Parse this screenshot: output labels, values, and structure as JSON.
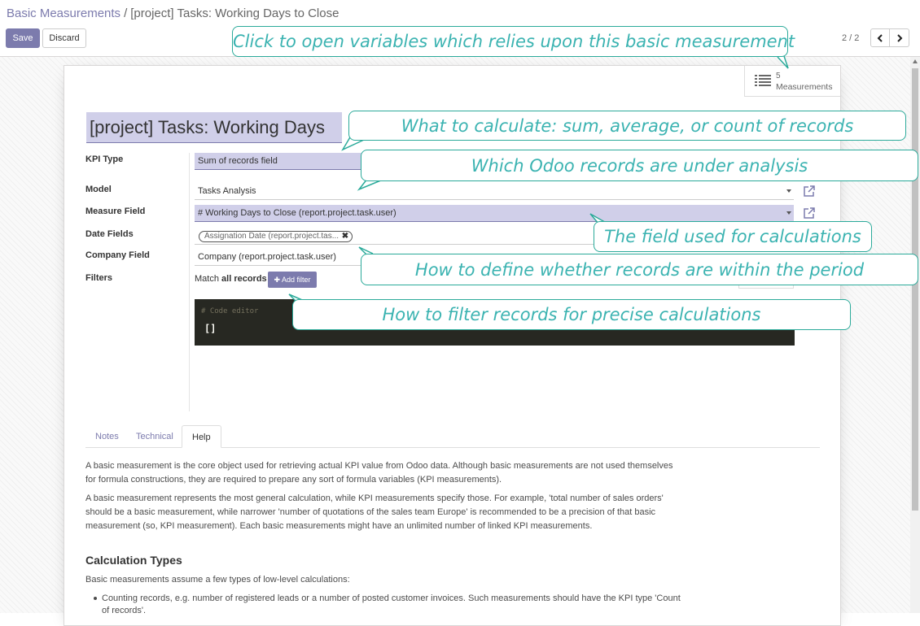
{
  "breadcrumb": {
    "parent": "Basic Measurements",
    "separator": "/",
    "current": "[project] Tasks: Working Days to Close"
  },
  "buttons": {
    "save": "Save",
    "discard": "Discard"
  },
  "pager": {
    "value": "2 / 2"
  },
  "stat_button": {
    "count": "5",
    "label": "Measurements",
    "icon": "list-icon"
  },
  "form": {
    "title": "[project] Tasks: Working Days",
    "fields": {
      "kpi_type": {
        "label": "KPI Type",
        "value": "Sum of records field"
      },
      "model": {
        "label": "Model",
        "value": "Tasks Analysis"
      },
      "measure_field": {
        "label": "Measure Field",
        "value": "# Working Days to Close (report.project.task.user)"
      },
      "date_fields": {
        "label": "Date Fields",
        "tag": "Assignation Date (report.project.tas...",
        "tag_remove": "✖"
      },
      "company_field": {
        "label": "Company Field",
        "value": "Company (report.project.task.user)"
      },
      "filters": {
        "label": "Filters",
        "match_prefix": "Match",
        "match_bold": "all records",
        "add_filter": "✚ Add filter"
      }
    },
    "code_editor": {
      "comment": "# Code editor",
      "content": "[]"
    }
  },
  "tabs": [
    {
      "label": "Notes"
    },
    {
      "label": "Technical"
    },
    {
      "label": "Help"
    }
  ],
  "help": {
    "p1": "A basic measurement is the core object used for retrieving actual KPI value from Odoo data. Although basic measurements are not used themselves for formula constructions, they are required to prepare any sort of formula variables (KPI measurements).",
    "p2": "A basic measurement represents the most general calculation, while KPI measurements specify those. For example, 'total number of sales orders' should be a basic measurement, while narrower 'number of quotations of the sales team Europe' is recommended to be a precision of that basic measurement (so, KPI measurement). Each basic measurements might have an unlimited number of linked KPI measurements.",
    "heading": "Calculation Types",
    "p3": "Basic measurements assume a few types of low-level calculations:",
    "list_item_1": "Counting records, e.g. number of registered leads or a number of posted customer invoices. Such measurements should have the KPI type 'Count of records'."
  },
  "callouts": {
    "measurements": "Click to open variables which relies upon this basic measurement",
    "kpi_type": "What to calculate: sum, average, or count of records",
    "model": "Which Odoo records are under analysis",
    "measure_field": "The field used for calculations",
    "date_fields": "How to define whether records are within the period",
    "filters": "How to filter records for precise calculations"
  },
  "colors": {
    "accent": "#7c7bad",
    "callout_border": "#2baa9a",
    "callout_text": "#3bb3b1",
    "highlight": "#d0cfe9"
  }
}
